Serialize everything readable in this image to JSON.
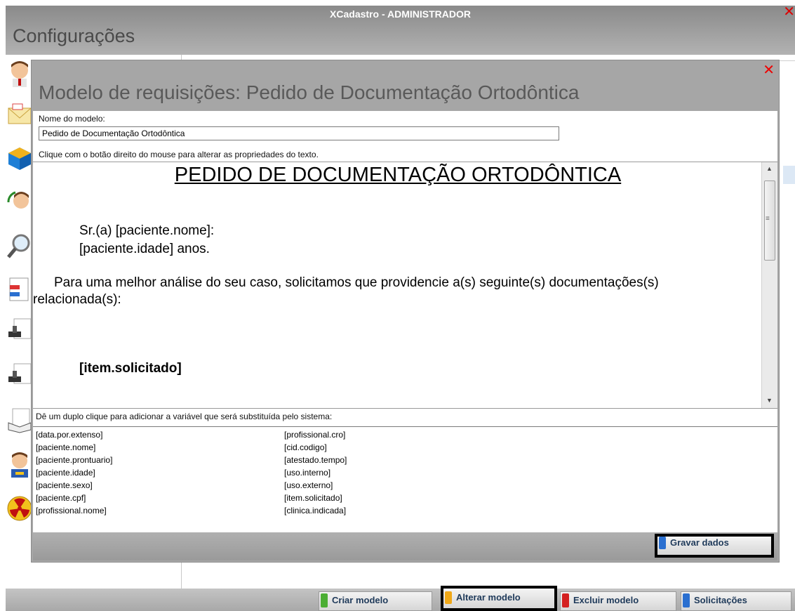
{
  "window": {
    "title": "XCadastro - ADMINISTRADOR",
    "close_glyph": "✕",
    "heading": "Configurações"
  },
  "sidebar": {
    "icons": [
      "user-avatar-icon",
      "envelope-icon",
      "cube-icon",
      "person-refresh-icon",
      "magnifier-icon",
      "document-form-icon",
      "stamp-icon",
      "stamp-icon",
      "book-icon",
      "doctor-icon",
      "radiation-icon"
    ]
  },
  "dialog": {
    "close_glyph": "✕",
    "title": "Modelo de requisições: Pedido de Documentação Ortodôntica",
    "name_label": "Nome do modelo:",
    "name_value": "Pedido de Documentação Ortodôntica",
    "editor_hint": "Clique com o botão direito do mouse para alterar as propriedades do texto.",
    "document": {
      "heading": "PEDIDO DE DOCUMENTAÇÃO ORTODÔNTICA",
      "greeting": "Sr.(a) [paciente.nome]:",
      "age_line": "[paciente.idade] anos.",
      "paragraph_line1": "Para uma melhor análise do seu caso, solicitamos que providencie a(s) seguinte(s) documentações(s)",
      "paragraph_line2": "relacionada(s):",
      "item_variable": "[item.solicitado]"
    },
    "variables_hint": "Dê um duplo clique para adicionar a variável que será substituída pelo sistema:",
    "variables_left": [
      "[data.por.extenso]",
      "[paciente.nome]",
      "[paciente.prontuario]",
      "[paciente.idade]",
      "[paciente.sexo]",
      "[paciente.cpf]",
      "[profissional.nome]"
    ],
    "variables_right": [
      "[profissional.cro]",
      "[cid.codigo]",
      "[atestado.tempo]",
      "[uso.interno]",
      "[uso.externo]",
      "[item.solicitado]",
      "[clinica.indicada]"
    ],
    "save_button": "Gravar dados"
  },
  "toolbar": {
    "create": "Criar modelo",
    "edit": "Alterar modelo",
    "delete": "Excluir modelo",
    "requests": "Solicitações"
  },
  "colors": {
    "create": "#4cae34",
    "edit": "#f0a818",
    "delete": "#d42020",
    "requests": "#2a6fd0",
    "save": "#2a6fd0"
  }
}
